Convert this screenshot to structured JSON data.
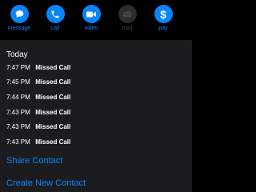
{
  "colors": {
    "accent": "#0a84ff",
    "disabled": "#3a3a3c",
    "background": "#000000",
    "panel": "#1c1c1e"
  },
  "actions": [
    {
      "label": "message",
      "icon": "message-bubble-icon",
      "enabled": true
    },
    {
      "label": "call",
      "icon": "phone-icon",
      "enabled": true
    },
    {
      "label": "video",
      "icon": "video-camera-icon",
      "enabled": true
    },
    {
      "label": "mail",
      "icon": "envelope-icon",
      "enabled": false
    },
    {
      "label": "pay",
      "icon": "dollar-icon",
      "enabled": true
    }
  ],
  "call_history": {
    "title": "Today",
    "entries": [
      {
        "time": "7:47 PM",
        "type": "Missed Call"
      },
      {
        "time": "7:45 PM",
        "type": "Missed Call"
      },
      {
        "time": "7:44 PM",
        "type": "Missed Call"
      },
      {
        "time": "7:43 PM",
        "type": "Missed Call"
      },
      {
        "time": "7:43 PM",
        "type": "Missed Call"
      },
      {
        "time": "7:43 PM",
        "type": "Missed Call"
      }
    ]
  },
  "contact_actions": {
    "share_label": "Share Contact",
    "create_label": "Create New Contact"
  }
}
